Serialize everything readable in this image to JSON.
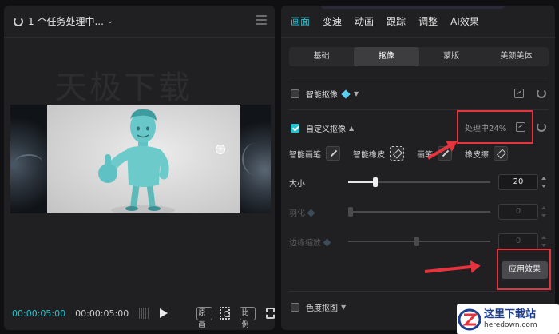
{
  "left": {
    "task_title": "1 个任务处理中...",
    "watermark": "天极下载",
    "time_current": "00:00:05:00",
    "time_total": "00:00:05:00",
    "btn_original": "原画",
    "btn_ratio": "比例"
  },
  "right": {
    "tabs": [
      "画面",
      "变速",
      "动画",
      "跟踪",
      "调整",
      "AI效果"
    ],
    "subtabs": [
      "基础",
      "抠像",
      "蒙版",
      "美颜美体"
    ],
    "smart_cutout": "智能抠像",
    "custom_cutout": "自定义抠像",
    "processing_status": "处理中24%",
    "tools": {
      "smart_brush": "智能画笔",
      "smart_eraser": "智能橡皮",
      "brush": "画笔",
      "eraser": "橡皮擦"
    },
    "size_label": "大小",
    "size_value": "20",
    "feather_label": "羽化",
    "feather_value": "0",
    "edge_label": "边缘缩放",
    "edge_value": "0",
    "apply_button": "应用效果",
    "chroma_key": "色度抠图"
  },
  "logo": {
    "cn": "这里下载站",
    "en": "heredown.com"
  },
  "colors": {
    "accent": "#23c4cf",
    "highlight_red": "#e5343e",
    "panel_bg": "#202022"
  }
}
